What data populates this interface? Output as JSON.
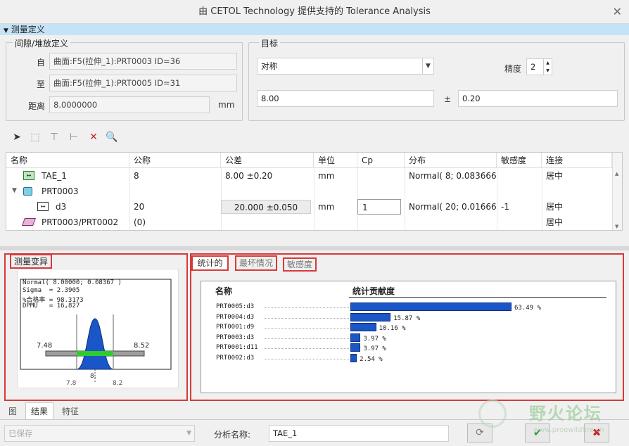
{
  "window": {
    "title": "由 CETOL Technology 提供支持的 Tolerance Analysis",
    "close": "✕"
  },
  "section": {
    "label": "测量定义"
  },
  "gap": {
    "title": "间隙/堆放定义",
    "from_label": "自",
    "from_value": "曲面:F5(拉伸_1):PRT0003 ID=36",
    "to_label": "至",
    "to_value": "曲面:F5(拉伸_1):PRT0005 ID=31",
    "dist_label": "距离",
    "dist_value": "8.0000000",
    "dist_unit": "mm"
  },
  "target": {
    "title": "目标",
    "type_value": "对称",
    "precision_label": "精度",
    "precision_value": "2",
    "nominal": "8.00",
    "pm": "±",
    "tol": "0.20"
  },
  "toolbar": {
    "icons": [
      "cursor-icon",
      "add-dimension-icon",
      "add-ref-icon",
      "add-datum-icon",
      "delete-icon",
      "preview-icon"
    ]
  },
  "table": {
    "headers": [
      "名称",
      "公称",
      "公差",
      "单位",
      "Cp",
      "分布",
      "敏感度",
      "连接"
    ],
    "rows": [
      {
        "name": "TAE_1",
        "nominal": "8",
        "tol": "8.00 ±0.20",
        "unit": "mm",
        "cp": "",
        "dist": "Normal( 8; 0.083666 )",
        "sens": "",
        "conn": "居中"
      },
      {
        "name": "PRT0003",
        "nominal": "",
        "tol": "",
        "unit": "",
        "cp": "",
        "dist": "",
        "sens": "",
        "conn": ""
      },
      {
        "name": "d3",
        "nominal": "20",
        "tol": "20.000 ±0.050",
        "unit": "mm",
        "cp": "1",
        "dist": "Normal( 20; 0.01666...",
        "sens": "-1",
        "conn": "居中"
      },
      {
        "name": "PRT0003/PRT0002",
        "nominal": "(0)",
        "tol": "",
        "unit": "",
        "cp": "",
        "dist": "",
        "sens": "",
        "conn": "居中"
      }
    ]
  },
  "variation": {
    "title": "测量变异",
    "lines": [
      "Normal( 8.00000; 0.08367 )",
      "Sigma  = 2.3905",
      "%合格率 = 98.3173",
      "DPMU   = 16,827"
    ],
    "lsl": "7.48",
    "usl": "8.52",
    "ticks": [
      "7.8",
      "8.",
      "8.2"
    ]
  },
  "tabs": {
    "stat": "统计的",
    "worst": "最坏情况",
    "sens": "敏感度"
  },
  "contrib": {
    "name_header": "名称",
    "value_header": "统计贡献度",
    "items": [
      {
        "name": "PRT0005:d3",
        "pct": 63.49,
        "label": "63.49 %"
      },
      {
        "name": "PRT0004:d3",
        "pct": 15.87,
        "label": "15.87 %"
      },
      {
        "name": "PRT0001:d9",
        "pct": 10.16,
        "label": "10.16 %"
      },
      {
        "name": "PRT0003:d3",
        "pct": 3.97,
        "label": "3.97 %"
      },
      {
        "name": "PRT0001:d11",
        "pct": 3.97,
        "label": "3.97 %"
      },
      {
        "name": "PRT0002:d3",
        "pct": 2.54,
        "label": "2.54 %"
      }
    ]
  },
  "bottom_tabs": {
    "graph": "图",
    "result": "结果",
    "feature": "特征"
  },
  "footer": {
    "saved_value": "已保存",
    "analysis_label": "分析名称:",
    "analysis_value": "TAE_1",
    "ok": "✔",
    "cancel": "✖"
  },
  "watermark": {
    "text": "野火论坛",
    "url": "www.proewildfire.cn"
  },
  "colors": {
    "section_bar": "#c4e3f7",
    "red_box": "#d83a3a",
    "bar_blue": "#1a56c8",
    "pass_green": "#2ecc2e"
  }
}
